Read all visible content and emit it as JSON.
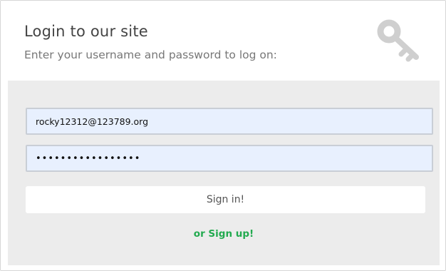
{
  "header": {
    "title": "Login to our site",
    "subtitle": "Enter your username and password to log on:",
    "icon": "key-icon"
  },
  "form": {
    "username_value": "rocky12312@123789.org",
    "password_value": "rocky12312passwrd",
    "signin_label": "Sign in!",
    "signup_label": "or Sign up!"
  },
  "colors": {
    "body_bg": "#ececec",
    "field_bg": "#e8f0fe",
    "signup_link": "#22aa4f",
    "icon": "#cfcfcf"
  }
}
